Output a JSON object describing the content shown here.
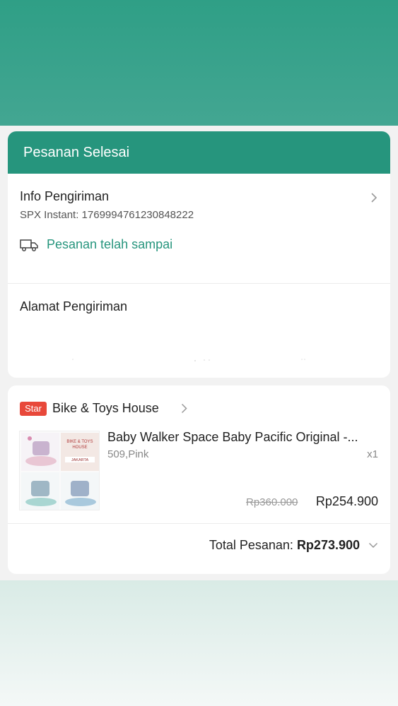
{
  "status": {
    "title": "Pesanan Selesai"
  },
  "shipping": {
    "title": "Info Pengiriman",
    "tracking": "SPX Instant: 1769994761230848222",
    "state": "Pesanan telah sampai"
  },
  "address": {
    "title": "Alamat Pengiriman"
  },
  "shop": {
    "badge": "Star",
    "name": "Bike & Toys House"
  },
  "item": {
    "name": "Baby Walker Space Baby Pacific Original -...",
    "variant": "509,Pink",
    "quantity": "x1",
    "original_price": "Rp360.000",
    "price": "Rp254.900",
    "thumbnail_caption": [
      "BIKE & TOYS",
      "HOUSE",
      "JAKARTA"
    ]
  },
  "total": {
    "label": "Total Pesanan:",
    "amount": "Rp273.900"
  },
  "colors": {
    "brand_green": "#26957d",
    "badge_red": "#e8483a"
  },
  "icons": {
    "shipping_chevron": "chevron-right-icon",
    "truck": "truck-icon",
    "shop_chevron": "chevron-right-icon",
    "total_chevron": "chevron-down-icon"
  }
}
